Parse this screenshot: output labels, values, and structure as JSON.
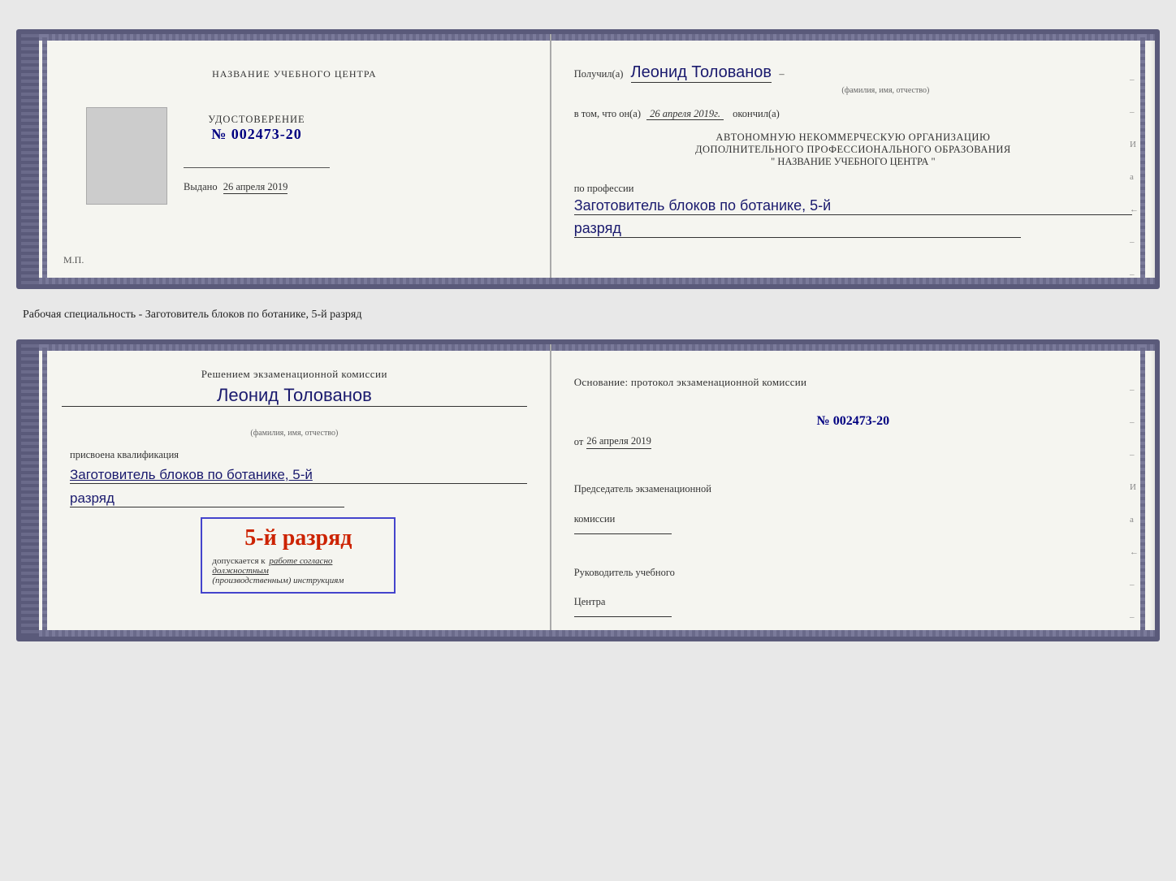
{
  "doc1": {
    "left": {
      "center_title": "НАЗВАНИЕ УЧЕБНОГО ЦЕНТРА",
      "cert_title": "УДОСТОВЕРЕНИЕ",
      "cert_number": "№ 002473-20",
      "issued_label": "Выдано",
      "issued_date": "26 апреля 2019",
      "mp_label": "М.П."
    },
    "right": {
      "received_label": "Получил(а)",
      "recipient_name": "Леонид Толованов",
      "name_subtext": "(фамилия, имя, отчество)",
      "confirm_text": "в том, что он(а)",
      "confirm_date": "26 апреля 2019г.",
      "confirm_end": "окончил(а)",
      "org_line1": "АВТОНОМНУЮ НЕКОММЕРЧЕСКУЮ ОРГАНИЗАЦИЮ",
      "org_line2": "ДОПОЛНИТЕЛЬНОГО ПРОФЕССИОНАЛЬНОГО ОБРАЗОВАНИЯ",
      "org_line3": "\"   НАЗВАНИЕ УЧЕБНОГО ЦЕНТРА   \"",
      "profession_label": "по профессии",
      "profession_value": "Заготовитель блоков по ботанике, 5-й",
      "razryad_value": "разряд"
    }
  },
  "separator": {
    "text": "Рабочая специальность - Заготовитель блоков по ботанике, 5-й разряд"
  },
  "doc2": {
    "left": {
      "decision_text": "Решением экзаменационной комиссии",
      "name_hw": "Леонид Толованов",
      "name_subtext": "(фамилия, имя, отчество)",
      "assigned_text": "присвоена квалификация",
      "qual_value": "Заготовитель блоков по ботанике, 5-й",
      "razryad_value": "разряд",
      "grade_number": "5-й разряд",
      "grade_allows": "допускается к",
      "grade_work": "работе согласно должностным",
      "grade_instructions": "(производственным) инструкциям"
    },
    "right": {
      "basis_text": "Основание: протокол экзаменационной комиссии",
      "protocol_number": "№  002473-20",
      "date_prefix": "от",
      "date_value": "26 апреля 2019",
      "chairman_label": "Председатель экзаменационной",
      "chairman_label2": "комиссии",
      "director_label": "Руководитель учебного",
      "director_label2": "Центра"
    }
  }
}
